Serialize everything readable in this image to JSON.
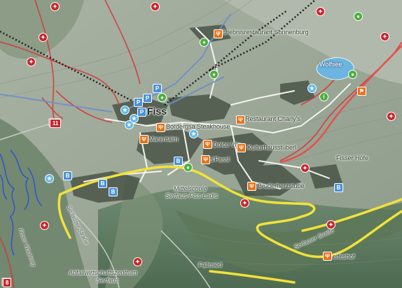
{
  "map": {
    "places": {
      "fiss": "Fiss",
      "wolfsee": "Wolfsee",
      "fisser_hoefe": "Fisser Höfe",
      "fallmied": "Fallmied",
      "serfaus_ladis_1": "Mittelschule",
      "serfaus_ladis_2": "Serfaus-Fiss-Ladis"
    },
    "pois": {
      "sonnenburg": "Erlebnisrestaurant Sonnenburg",
      "charlys": "Restaurant Charly's",
      "steakhouse": "Bordergsa Steakhouse",
      "marentalm": "Marentalm",
      "dolce_vita": "Dolce Vita",
      "kultur": "Kulturhausstüberl",
      "sfassl": "s'Fassl",
      "bruderherz": "Bruderherzstube",
      "abfall_1": "Abfallwirtschaftszentrum",
      "abfall_2": "Serfaus",
      "elfeshof": "elfeshof"
    },
    "roads": {
      "serfauser_strasse_1": "Serfauser Straße",
      "serfauser_strasse_2": "Serfauser Straße",
      "road_number": "11",
      "road_number_2": "8",
      "trail_label": "Fisser Waalweg"
    },
    "icons": {
      "hiking": "hiking-icon",
      "restaurant": "restaurant-icon",
      "parking": "parking-icon",
      "bus": "bus-icon",
      "viewpoint": "viewpoint-star-icon"
    }
  }
}
